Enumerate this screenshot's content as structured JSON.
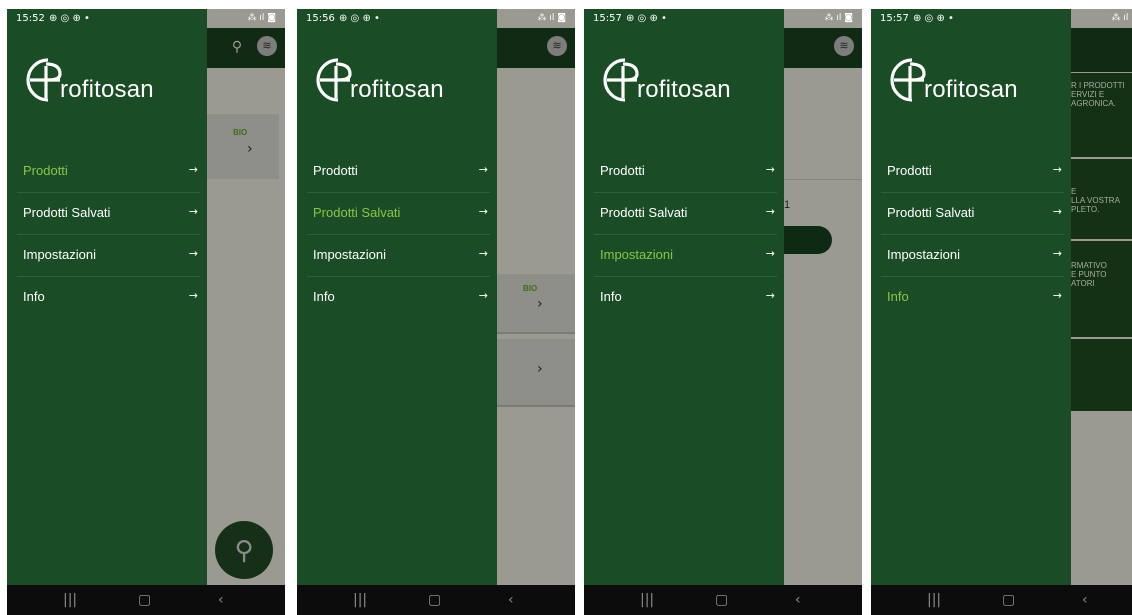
{
  "brand": {
    "logo_text": "rofitosan"
  },
  "icons": {
    "arrow": "→",
    "search": "🔍",
    "wifi": "≋",
    "chevron_right": "›",
    "chevron_down": "⌄"
  },
  "colors": {
    "drawer": "#1a4d25",
    "active": "#8bc34a",
    "text": "#ffffff"
  },
  "screens": [
    {
      "time": "15:52",
      "status_icons": "⊕ ◎ ⊕ •",
      "signal": "⁂ ıl ◙",
      "menu": [
        {
          "label": "Prodotti",
          "active": true
        },
        {
          "label": "Prodotti Salvati",
          "active": false
        },
        {
          "label": "Impostazioni",
          "active": false
        },
        {
          "label": "Info",
          "active": false
        }
      ],
      "bg_badge": "BIO"
    },
    {
      "time": "15:56",
      "status_icons": "⊕ ◎ ⊕ •",
      "signal": "⁂ ıl ◙",
      "menu": [
        {
          "label": "Prodotti",
          "active": false
        },
        {
          "label": "Prodotti Salvati",
          "active": true
        },
        {
          "label": "Impostazioni",
          "active": false
        },
        {
          "label": "Info",
          "active": false
        }
      ],
      "bg_badge": "BIO"
    },
    {
      "time": "15:57",
      "status_icons": "⊕ ◎ ⊕ •",
      "signal": "⁂ ıl ◙",
      "menu": [
        {
          "label": "Prodotti",
          "active": false
        },
        {
          "label": "Prodotti Salvati",
          "active": false
        },
        {
          "label": "Impostazioni",
          "active": true
        },
        {
          "label": "Info",
          "active": false
        }
      ],
      "bg_fragment": "1"
    },
    {
      "time": "15:57",
      "status_icons": "⊕ ◎ ⊕ •",
      "signal": "⁂ ıl ◙",
      "menu": [
        {
          "label": "Prodotti",
          "active": false
        },
        {
          "label": "Prodotti Salvati",
          "active": false
        },
        {
          "label": "Impostazioni",
          "active": false
        },
        {
          "label": "Info",
          "active": true
        }
      ],
      "bg_cards": [
        "R I PRODOTTI\nERVIZI E\nAGRONICA.",
        "E\nLLA VOSTRA\nPLETO.",
        "RMATIVO\nE PUNTO\nATORI",
        ""
      ]
    }
  ]
}
